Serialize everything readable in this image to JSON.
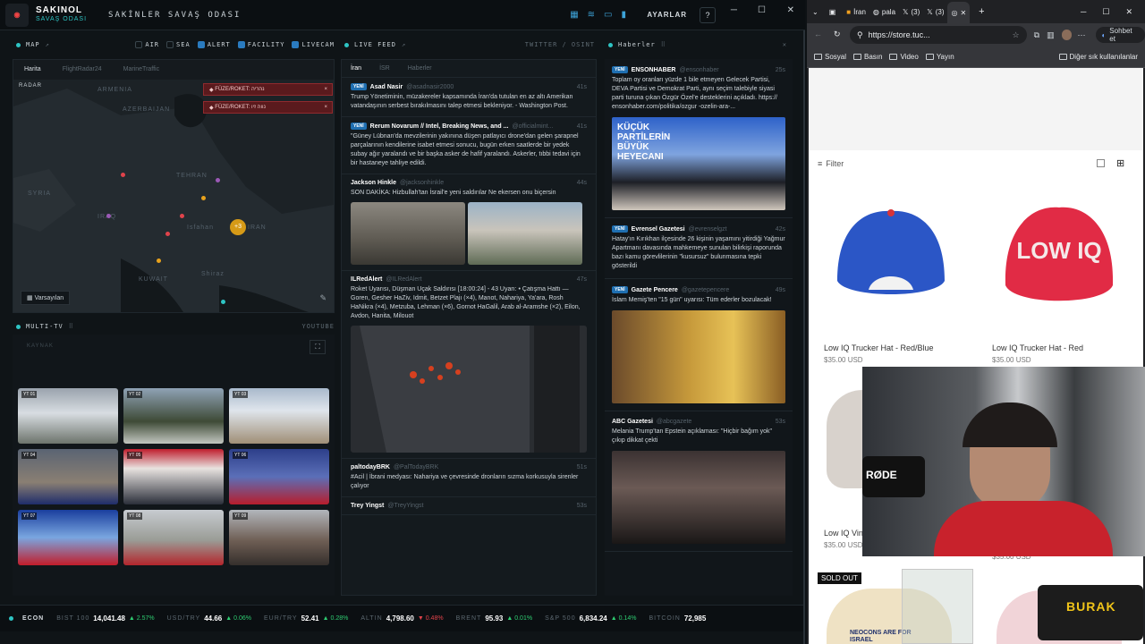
{
  "topbar": {
    "brand": "SAKINOL",
    "brand_sub": "SAVAŞ ODASI",
    "room_title": "SAKİNLER SAVAŞ ODASI",
    "settings_label": "AYARLAR",
    "help_label": "?"
  },
  "map": {
    "header": "MAP",
    "filters": [
      {
        "label": "AIR",
        "checked": false
      },
      {
        "label": "SEA",
        "checked": false
      },
      {
        "label": "ALERT",
        "checked": true
      },
      {
        "label": "FACILITY",
        "checked": true
      },
      {
        "label": "LIVECAM",
        "checked": true
      }
    ],
    "tabs": [
      "Harita",
      "FlightRadar24",
      "MarineTraffic"
    ],
    "radar_label": "RADAR",
    "alerts": [
      "FÜZE/ROKET: נהריה",
      "FÜZE/ROKET: נווה זיו"
    ],
    "places": [
      "ARMENIA",
      "AZERBAIJAN",
      "TEHRAN",
      "SYRIA",
      "IRAQ",
      "KUWAIT",
      "IRAN",
      "Isfahan",
      "Shiraz"
    ],
    "cluster_count": "+3",
    "default_view_label": "Varsayılan"
  },
  "multitv": {
    "header": "MULTI-TV",
    "source": "YOUTUBE",
    "kaynak_label": "KAYNAK",
    "tiles": [
      "YT 01",
      "YT 02",
      "YT 03",
      "YT 04",
      "YT 05",
      "YT 06",
      "YT 07",
      "YT 08",
      "YT 09"
    ]
  },
  "feed": {
    "header": "LIVE FEED",
    "source": "TWITTER / OSINT",
    "tabs": [
      "İran",
      "İSR",
      "Haberler"
    ],
    "posts": [
      {
        "badge": "YENİ",
        "name": "Asad Nasir",
        "handle": "@asadnasir2000",
        "time": "41s",
        "text": "Trump Yönetiminin, müzakereler kapsamında İran'da tutulan en az altı Amerikan vatandaşının serbest bırakılmasını talep etmesi bekleniyor. - Washington Post."
      },
      {
        "badge": "YENİ",
        "name": "Rerum Novarum // Intel, Breaking News, and ...",
        "handle": "@officialmint...",
        "time": "41s",
        "text": "\"Güney Lübnan'da mevzilerinin yakınına düşen patlayıcı drone'dan gelen şarapnel parçalarının kendilerine isabet etmesi sonucu, bugün erken saatlerde bir yedek subay ağır yaralandı ve bir başka asker de hafif yaralandı. Askerler, tıbbi tedavi için bir hastaneye tahliye edildi."
      },
      {
        "badge": "",
        "name": "Jackson Hinkle",
        "handle": "@jacksonhinkle",
        "time": "44s",
        "text": "SON DAKİKA: Hizbullah'tan İsrail'e yeni saldırılar Ne ekersen onu biçersin"
      },
      {
        "badge": "",
        "name": "ILRedAlert",
        "handle": "@ILRedAlert",
        "time": "47s",
        "text": "Roket Uyarısı, Düşman Uçak Saldırısı [18:00:24] - 43 Uyarı: • Çatışma Hattı — Goren, Gesher HaZiv, Idmit, Betzet Plajı (×4), Manot, Nahariya, Ya'ara, Rosh HaNikra (×4), Metzuba, Lehman (×6), Gornot HaGalil, Arab al-Aramshe (×2), Eilon, Avdon, Hanita, Milouot"
      },
      {
        "badge": "",
        "name": "paltodayBRK",
        "handle": "@PalTodayBRK",
        "time": "51s",
        "text": "#Acil | İbrani medyası: Nahariya ve çevresinde dronların sızma korkusuyla sirenler çalıyor"
      },
      {
        "badge": "",
        "name": "Trey Yingst",
        "handle": "@TreyYingst",
        "time": "53s",
        "text": ""
      }
    ]
  },
  "news": {
    "header": "Haberler",
    "items": [
      {
        "badge": "YENİ",
        "source": "ENSONHABER",
        "handle": "@ensonhaber",
        "time": "25s",
        "text": "Toplam oy oranları yüzde 1 bile etmeyen Gelecek Partisi, DEVA Partisi ve Demokrat Parti, aynı seçim talebiyle siyasi parti turuna çıkan Özgür Özel'e desteklerini açıkladı. https:// ensonhaber.com/politika/ozgur -ozelin-ara-...",
        "img_text": "KÜÇÜK PARTİLERİN BÜYÜK HEYECANI"
      },
      {
        "badge": "YENİ",
        "source": "Evrensel Gazetesi",
        "handle": "@evrenselgzt",
        "time": "42s",
        "text": "Hatay'ın Kırıkhan ilçesinde 26 kişinin yaşamını yitirdiği Yağmur Apartmanı davasında mahkemeye sunulan bilirkişi raporunda bazı kamu görevlilerinin \"kusursuz\" bulunmasına tepki gösterildi",
        "img_text": ""
      },
      {
        "badge": "YENİ",
        "source": "Gazete Pencere",
        "handle": "@gazetepencere",
        "time": "49s",
        "text": "İslam Memiş'ten \"15 gün\" uyarısı: Tüm ederler bozulacak!",
        "img_text": ""
      },
      {
        "badge": "",
        "source": "ABC Gazetesi",
        "handle": "@abcgazete",
        "time": "53s",
        "text": "Melania Trump'tan Epstein açıklaması: \"Hiçbir bağım yok\" çıkıp dikkat çekti",
        "img_text": ""
      }
    ]
  },
  "ticker": {
    "label": "ECON",
    "items": [
      {
        "name": "BIST 100",
        "value": "14,041.48",
        "change": "▲ 2.57%",
        "dir": "up"
      },
      {
        "name": "USD/TRY",
        "value": "44.66",
        "change": "▲ 0.06%",
        "dir": "up"
      },
      {
        "name": "EUR/TRY",
        "value": "52.41",
        "change": "▲ 0.28%",
        "dir": "up"
      },
      {
        "name": "ALTIN",
        "value": "4,798.60",
        "change": "▼ 0.48%",
        "dir": "down"
      },
      {
        "name": "BRENT",
        "value": "95.93",
        "change": "▲ 0.01%",
        "dir": "up"
      },
      {
        "name": "S&P 500",
        "value": "6,834.24",
        "change": "▲ 0.14%",
        "dir": "up"
      },
      {
        "name": "BITCOIN",
        "value": "72,985",
        "change": "",
        "dir": "up"
      }
    ]
  },
  "browser": {
    "tabs": [
      "İran",
      "pala",
      "(3)",
      "(3)"
    ],
    "url": "https://store.tuc...",
    "chat_label": "Sohbet et",
    "bookmarks": [
      "Sosyal",
      "Basın",
      "Video",
      "Yayın"
    ],
    "other_bookmarks": "Diğer sık kullanılanlar",
    "filter_label": "Filter",
    "products": [
      {
        "title": "Low IQ Trucker Hat - Red/Blue",
        "price": "$35.00 USD"
      },
      {
        "title": "Low IQ Trucker Hat - Red",
        "price": "$35.00 USD"
      },
      {
        "title": "Low IQ Vin",
        "price": "$35.00 USD"
      },
      {
        "title": "",
        "price": "$35.00 USD"
      }
    ],
    "hat_text": "LOW IQ",
    "sold_out": "SOLD OUT",
    "neocon_text": "NEOCONS ARE FOR ISRAEL"
  },
  "overlay": {
    "mic_brand": "RØDE",
    "streamer_name": "BURAK"
  }
}
